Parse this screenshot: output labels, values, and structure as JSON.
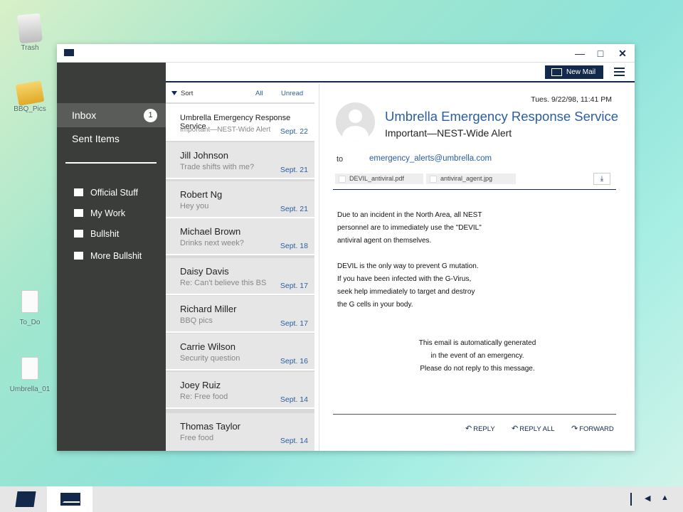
{
  "desktop": {
    "icons": [
      {
        "label": "Trash"
      },
      {
        "label": "BBQ_Pics"
      },
      {
        "label": "To_Do"
      },
      {
        "label": "Umbrella_01"
      }
    ]
  },
  "window": {
    "controls": {
      "minimize": "—",
      "maximize": "□",
      "close": "✕"
    }
  },
  "sidebar": {
    "inbox_label": "Inbox",
    "inbox_count": "1",
    "sent_label": "Sent Items",
    "folders": [
      "Official Stuff",
      "My Work",
      "Bullshit",
      "More Bullshit"
    ]
  },
  "toolbar": {
    "new_mail_label": "New Mail"
  },
  "list": {
    "sort_label": "Sort",
    "all_label": "All",
    "unread_label": "Unread",
    "messages": [
      {
        "from": "Umbrella Emergency Response Service",
        "subject": "Important—NEST-Wide Alert",
        "date": "Sept. 22"
      },
      {
        "from": "Jill Johnson",
        "subject": "Trade shifts with me?",
        "date": "Sept. 21"
      },
      {
        "from": "Robert Ng",
        "subject": "Hey you",
        "date": "Sept. 21"
      },
      {
        "from": "Michael Brown",
        "subject": "Drinks next week?",
        "date": "Sept. 18"
      },
      {
        "from": "Daisy Davis",
        "subject": "Re: Can't believe this BS",
        "date": "Sept. 17"
      },
      {
        "from": "Richard Miller",
        "subject": "BBQ pics",
        "date": "Sept. 17"
      },
      {
        "from": "Carrie Wilson",
        "subject": "Security question",
        "date": "Sept. 16"
      },
      {
        "from": "Joey Ruiz",
        "subject": "Re: Free food",
        "date": "Sept. 14"
      },
      {
        "from": "Thomas Taylor",
        "subject": "Free food",
        "date": "Sept. 14"
      }
    ]
  },
  "reader": {
    "timestamp": "Tues. 9/22/98, 11:41 PM",
    "from": "Umbrella Emergency Response Service",
    "subject": "Important—NEST-Wide Alert",
    "to_label": "to",
    "to_address": "emergency_alerts@umbrella.com",
    "attachments": [
      "DEVIL_antiviral.pdf",
      "antiviral_agent.jpg"
    ],
    "body": [
      "Due to an incident in the North Area, all NEST",
      "personnel are to immediately use the \"DEVIL\"",
      "antiviral agent on themselves.",
      "DEVIL is the only way to prevent G mutation.",
      "If you have been infected with the G-Virus,",
      "seek help immediately to target and destroy",
      "the G cells in your body."
    ],
    "footer": [
      "This email is automatically generated",
      "in the event of an emergency.",
      "Please do not reply to this message."
    ],
    "actions": {
      "reply": "REPLY",
      "reply_all": "REPLY ALL",
      "forward": "FORWARD"
    }
  },
  "taskbar": {
    "tray": {
      "volume": "◀",
      "arrow": "▲"
    }
  }
}
